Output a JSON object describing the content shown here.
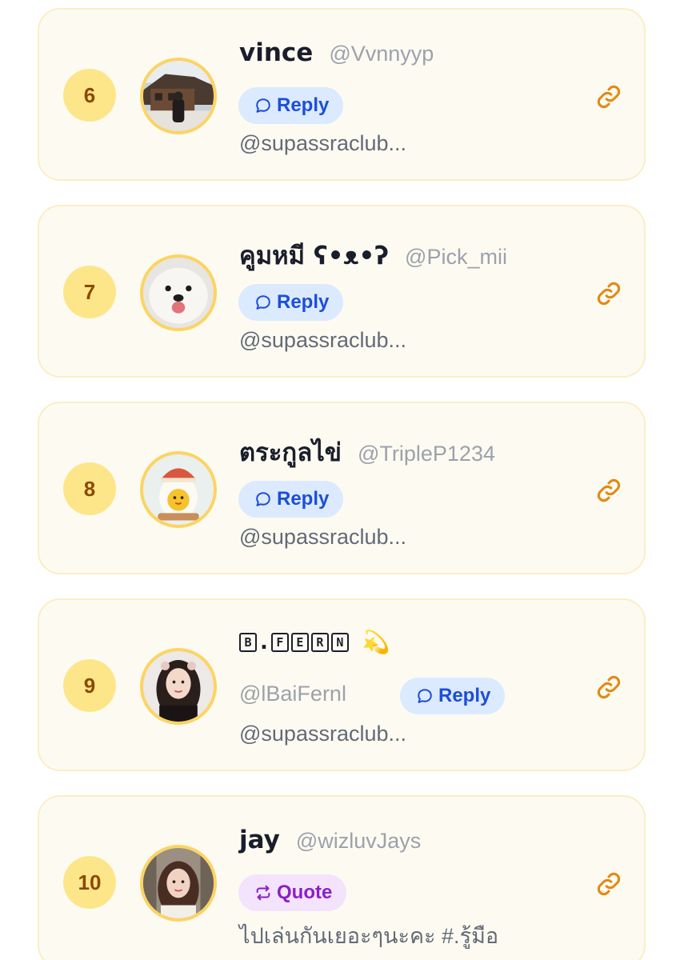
{
  "entries": [
    {
      "rank": "6",
      "name": "vince",
      "handle": "@Vvnnyyp",
      "action": "Reply",
      "snippet": "@supassraclub..."
    },
    {
      "rank": "7",
      "name": "คูมหมี ʕ•ᴥ•ʔ",
      "handle": "@Pick_mii",
      "action": "Reply",
      "snippet": "@supassraclub..."
    },
    {
      "rank": "8",
      "name": "ตระกูลไข่",
      "handle": "@TripleP1234",
      "action": "Reply",
      "snippet": "@supassraclub..."
    },
    {
      "rank": "9",
      "name_letters": [
        "B",
        ".",
        "F",
        "E",
        "R",
        "N"
      ],
      "name_emoji": "💫",
      "handle": "@lBaiFernl",
      "action": "Reply",
      "snippet": "@supassraclub..."
    },
    {
      "rank": "10",
      "name": "jay",
      "handle": "@wizluvJays",
      "action": "Quote",
      "snippet": "ไปเล่นกันเยอะๆนะคะ #.รู้มือ"
    }
  ],
  "icons": {
    "reply": "speech-bubble-icon",
    "quote": "repeat-arrows-icon",
    "link": "chain-link-icon"
  },
  "colors": {
    "card_bg": "#fdfbf1",
    "card_border": "#fbeec6",
    "rank_bg": "#fde68a",
    "rank_text": "#8a4a06",
    "reply_bg": "#dbeafe",
    "reply_text": "#1d4ed8",
    "quote_bg": "#f3e3fc",
    "quote_text": "#8b1fc6",
    "link_icon": "#e38a17"
  }
}
